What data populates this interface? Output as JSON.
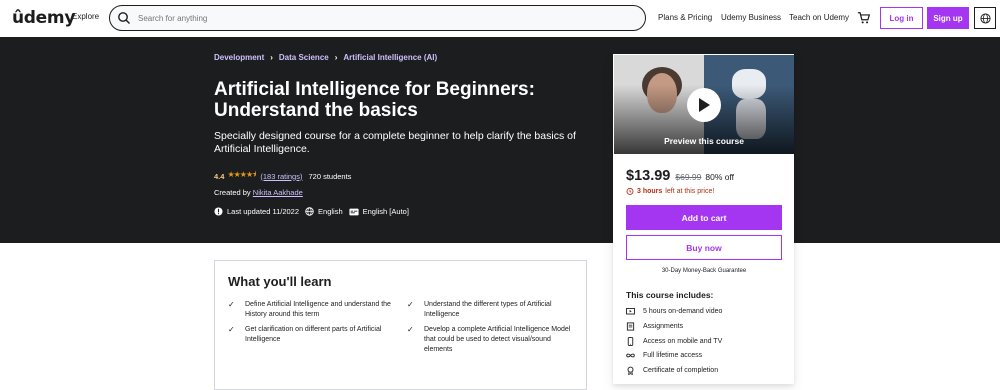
{
  "header": {
    "logo": "ûdemy",
    "explore": "Explore",
    "search_placeholder": "Search for anything",
    "nav": [
      "Plans & Pricing",
      "Udemy Business",
      "Teach on Udemy"
    ],
    "login": "Log in",
    "signup": "Sign up"
  },
  "hero": {
    "breadcrumbs": [
      "Development",
      "Data Science",
      "Artificial Intelligence (AI)"
    ],
    "title": "Artificial Intelligence for Beginners: Understand the basics",
    "subtitle": "Specially designed course for a complete beginner to help clarify the basics of Artificial Intelligence.",
    "rating": "4.4",
    "stars": "★★★★⯨",
    "ratings_count": "(183 ratings)",
    "students": "720 students",
    "created_by_label": "Created by",
    "author": "Nikita Aakhade",
    "last_updated": "Last updated 11/2022",
    "language": "English",
    "captions": "English [Auto]"
  },
  "sidebar": {
    "preview_label": "Preview this course",
    "price": "$13.99",
    "original_price": "$69.99",
    "discount": "80% off",
    "time_left_bold": "3 hours",
    "time_left_rest": "left at this price!",
    "add_to_cart": "Add to cart",
    "buy_now": "Buy now",
    "guarantee": "30-Day Money-Back Guarantee",
    "includes_heading": "This course includes:",
    "includes": [
      {
        "icon": "video-icon",
        "text": "5 hours on-demand video"
      },
      {
        "icon": "assignment-icon",
        "text": "Assignments"
      },
      {
        "icon": "mobile-icon",
        "text": "Access on mobile and TV"
      },
      {
        "icon": "infinity-icon",
        "text": "Full lifetime access"
      },
      {
        "icon": "certificate-icon",
        "text": "Certificate of completion"
      }
    ]
  },
  "learn": {
    "heading": "What you'll learn",
    "points": [
      "Define Artificial Intelligence and understand the History around this term",
      "Understand the different types of Artificial Intelligence",
      "Get clarification on different parts of Artificial Intelligence",
      "Develop a complete Artificial Intelligence Model that could be used to detect visual/sound elements"
    ]
  },
  "colors": {
    "brand": "#a435f0",
    "hero_bg": "#1c1d1f",
    "star": "#e59819",
    "link_light": "#cec0fc",
    "urgent": "#b32d0f"
  }
}
